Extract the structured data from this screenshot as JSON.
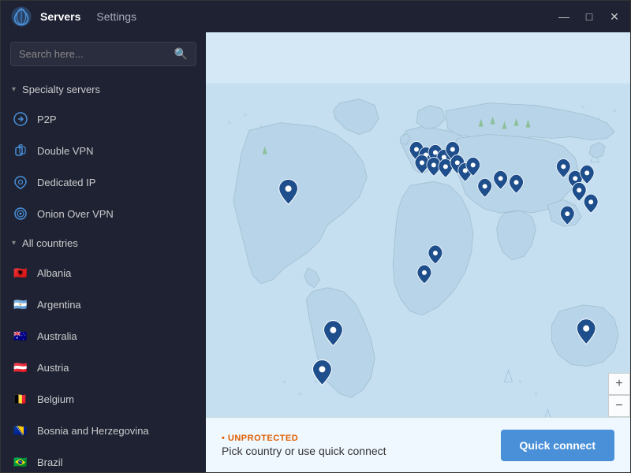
{
  "titleBar": {
    "navItems": [
      {
        "label": "Servers",
        "active": true
      },
      {
        "label": "Settings",
        "active": false
      }
    ],
    "controls": {
      "minimize": "—",
      "maximize": "□",
      "close": "✕"
    }
  },
  "sidebar": {
    "search": {
      "placeholder": "Search here...",
      "iconLabel": "search-icon"
    },
    "specialtySection": {
      "label": "Specialty servers",
      "expanded": true
    },
    "specialtyItems": [
      {
        "label": "P2P",
        "icon": "shield"
      },
      {
        "label": "Double VPN",
        "icon": "lock"
      },
      {
        "label": "Dedicated IP",
        "icon": "home"
      },
      {
        "label": "Onion Over VPN",
        "icon": "circle"
      }
    ],
    "allCountriesSection": {
      "label": "All countries",
      "expanded": true
    },
    "countries": [
      {
        "label": "Albania",
        "flag": "🇦🇱"
      },
      {
        "label": "Argentina",
        "flag": "🇦🇷"
      },
      {
        "label": "Australia",
        "flag": "🇦🇺"
      },
      {
        "label": "Austria",
        "flag": "🇦🇹"
      },
      {
        "label": "Belgium",
        "flag": "🇧🇪"
      },
      {
        "label": "Bosnia and Herzegovina",
        "flag": "🇧🇦"
      },
      {
        "label": "Brazil",
        "flag": "🇧🇷"
      }
    ]
  },
  "bottomBar": {
    "statusLabel": "• UNPROTECTED",
    "statusText": "Pick country or use quick connect",
    "quickConnectLabel": "Quick connect"
  },
  "mapControls": {
    "zoomIn": "+",
    "zoomOut": "−"
  }
}
